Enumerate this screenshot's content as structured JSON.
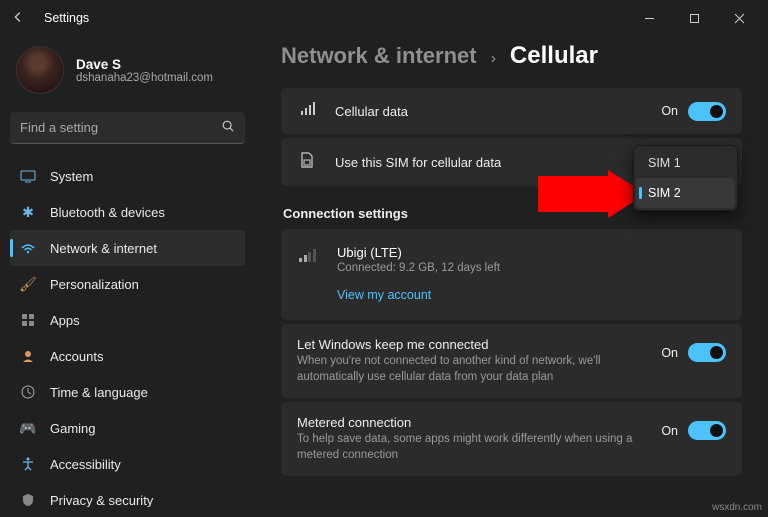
{
  "window": {
    "title": "Settings"
  },
  "profile": {
    "name": "Dave S",
    "email": "dshanaha23@hotmail.com"
  },
  "search": {
    "placeholder": "Find a setting"
  },
  "sidebar": {
    "items": [
      {
        "label": "System"
      },
      {
        "label": "Bluetooth & devices"
      },
      {
        "label": "Network & internet"
      },
      {
        "label": "Personalization"
      },
      {
        "label": "Apps"
      },
      {
        "label": "Accounts"
      },
      {
        "label": "Time & language"
      },
      {
        "label": "Gaming"
      },
      {
        "label": "Accessibility"
      },
      {
        "label": "Privacy & security"
      }
    ]
  },
  "breadcrumb": {
    "parent": "Network & internet",
    "current": "Cellular"
  },
  "rows": {
    "cellular_data": {
      "title": "Cellular data",
      "state": "On"
    },
    "sim_select": {
      "title": "Use this SIM for cellular data"
    },
    "keep_connected": {
      "title": "Let Windows keep me connected",
      "sub": "When you're not connected to another kind of network, we'll automatically use cellular data from your data plan",
      "state": "On"
    },
    "metered": {
      "title": "Metered connection",
      "sub": "To help save data, some apps might work differently when using a metered connection",
      "state": "On"
    }
  },
  "connection_section": {
    "title": "Connection settings"
  },
  "provider": {
    "name": "Ubigi (LTE)",
    "status": "Connected: 9.2 GB, 12 days left",
    "link": "View my account"
  },
  "sim_menu": {
    "options": [
      "SIM 1",
      "SIM 2"
    ],
    "selected": "SIM 2"
  },
  "watermark": "wsxdn.com"
}
